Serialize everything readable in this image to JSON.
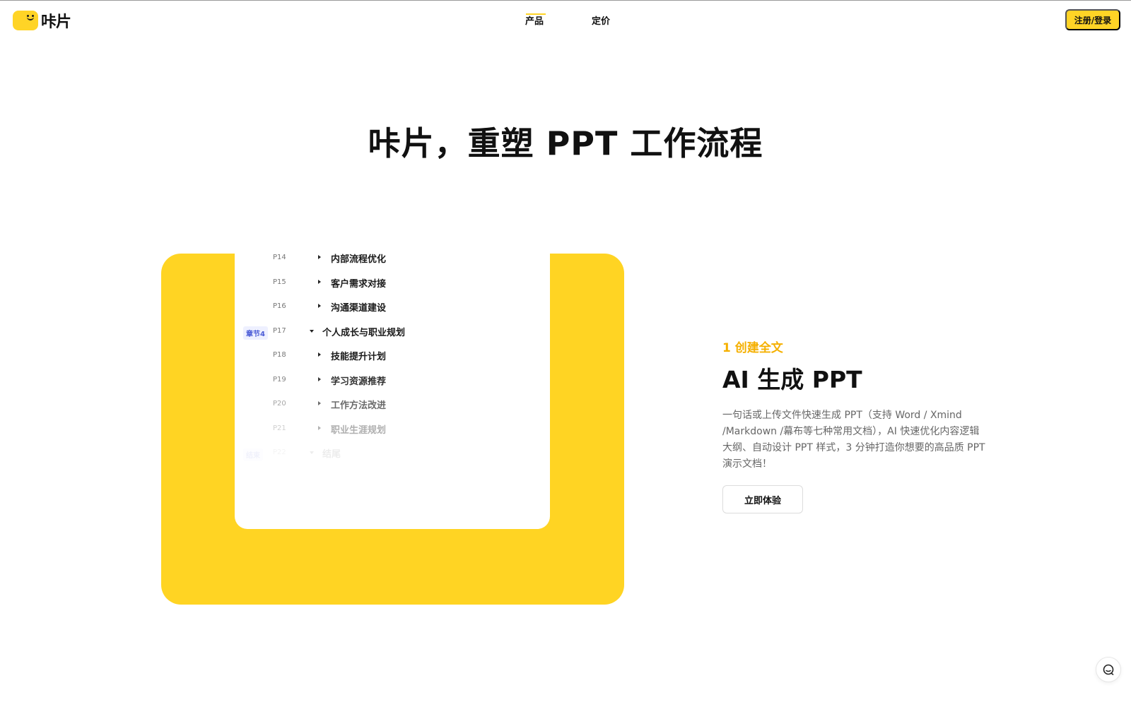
{
  "brand": {
    "name": "咔片",
    "accent_color": "#ffd426"
  },
  "nav": {
    "items": [
      {
        "label": "产品",
        "active": true
      },
      {
        "label": "定价",
        "active": false
      }
    ],
    "signup_label": "注册/登录"
  },
  "hero": {
    "title": "咔片，重塑 PPT 工作流程"
  },
  "outline": {
    "rows": [
      {
        "page": "P14",
        "text": "内部流程优化",
        "level": 2,
        "opacity": 1
      },
      {
        "page": "P15",
        "text": "客户需求对接",
        "level": 2,
        "opacity": 1
      },
      {
        "page": "P16",
        "text": "沟通渠道建设",
        "level": 2,
        "opacity": 1
      },
      {
        "badge": "章节4",
        "page": "P17",
        "text": "个人成长与职业规划",
        "level": 1,
        "opacity": 1
      },
      {
        "page": "P18",
        "text": "技能提升计划",
        "level": 2,
        "opacity": 1
      },
      {
        "page": "P19",
        "text": "学习资源推荐",
        "level": 2,
        "opacity": 0.9
      },
      {
        "page": "P20",
        "text": "工作方法改进",
        "level": 2,
        "opacity": 0.65
      },
      {
        "page": "P21",
        "text": "职业生涯规划",
        "level": 2,
        "opacity": 0.35
      },
      {
        "badge": "结束",
        "page": "P22",
        "text": "结尾",
        "level": 1,
        "opacity": 0.08
      }
    ]
  },
  "feature": {
    "step_label": "1 创建全文",
    "title": "AI 生成 PPT",
    "description": "一句话或上传文件快速生成 PPT（支持 Word / Xmind /Markdown /幕布等七种常用文档），AI 快速优化内容逻辑大纲、自动设计 PPT 样式，3 分钟打造你想要的高品质 PPT 演示文档！",
    "cta_label": "立即体验"
  },
  "icons": {
    "chat": "chat-icon",
    "collapse": "caret-right-icon",
    "expand": "caret-down-icon"
  }
}
